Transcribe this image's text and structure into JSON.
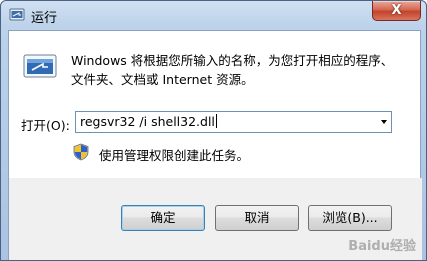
{
  "window": {
    "title": "运行",
    "close_label": "X"
  },
  "description": {
    "line1": "Windows 将根据您所输入的名称，为您打开相应的程序、",
    "line2": "文件夹、文档或 Internet 资源。"
  },
  "open_field": {
    "label": "打开(O):",
    "value": "regsvr32 /i shell32.dll"
  },
  "admin_note": "使用管理权限创建此任务。",
  "buttons": {
    "ok": "确定",
    "cancel": "取消",
    "browse": "浏览(B)..."
  },
  "watermark": "Baidu经验",
  "icons": {
    "app": "run-dialog-icon",
    "shield": "uac-shield-icon",
    "dropdown": "chevron-down-icon"
  },
  "colors": {
    "title_bar": "#bcd2ea",
    "close_button": "#c2442b",
    "footer_bg": "#f0f0f0",
    "default_button_border": "#3c7fb1"
  }
}
